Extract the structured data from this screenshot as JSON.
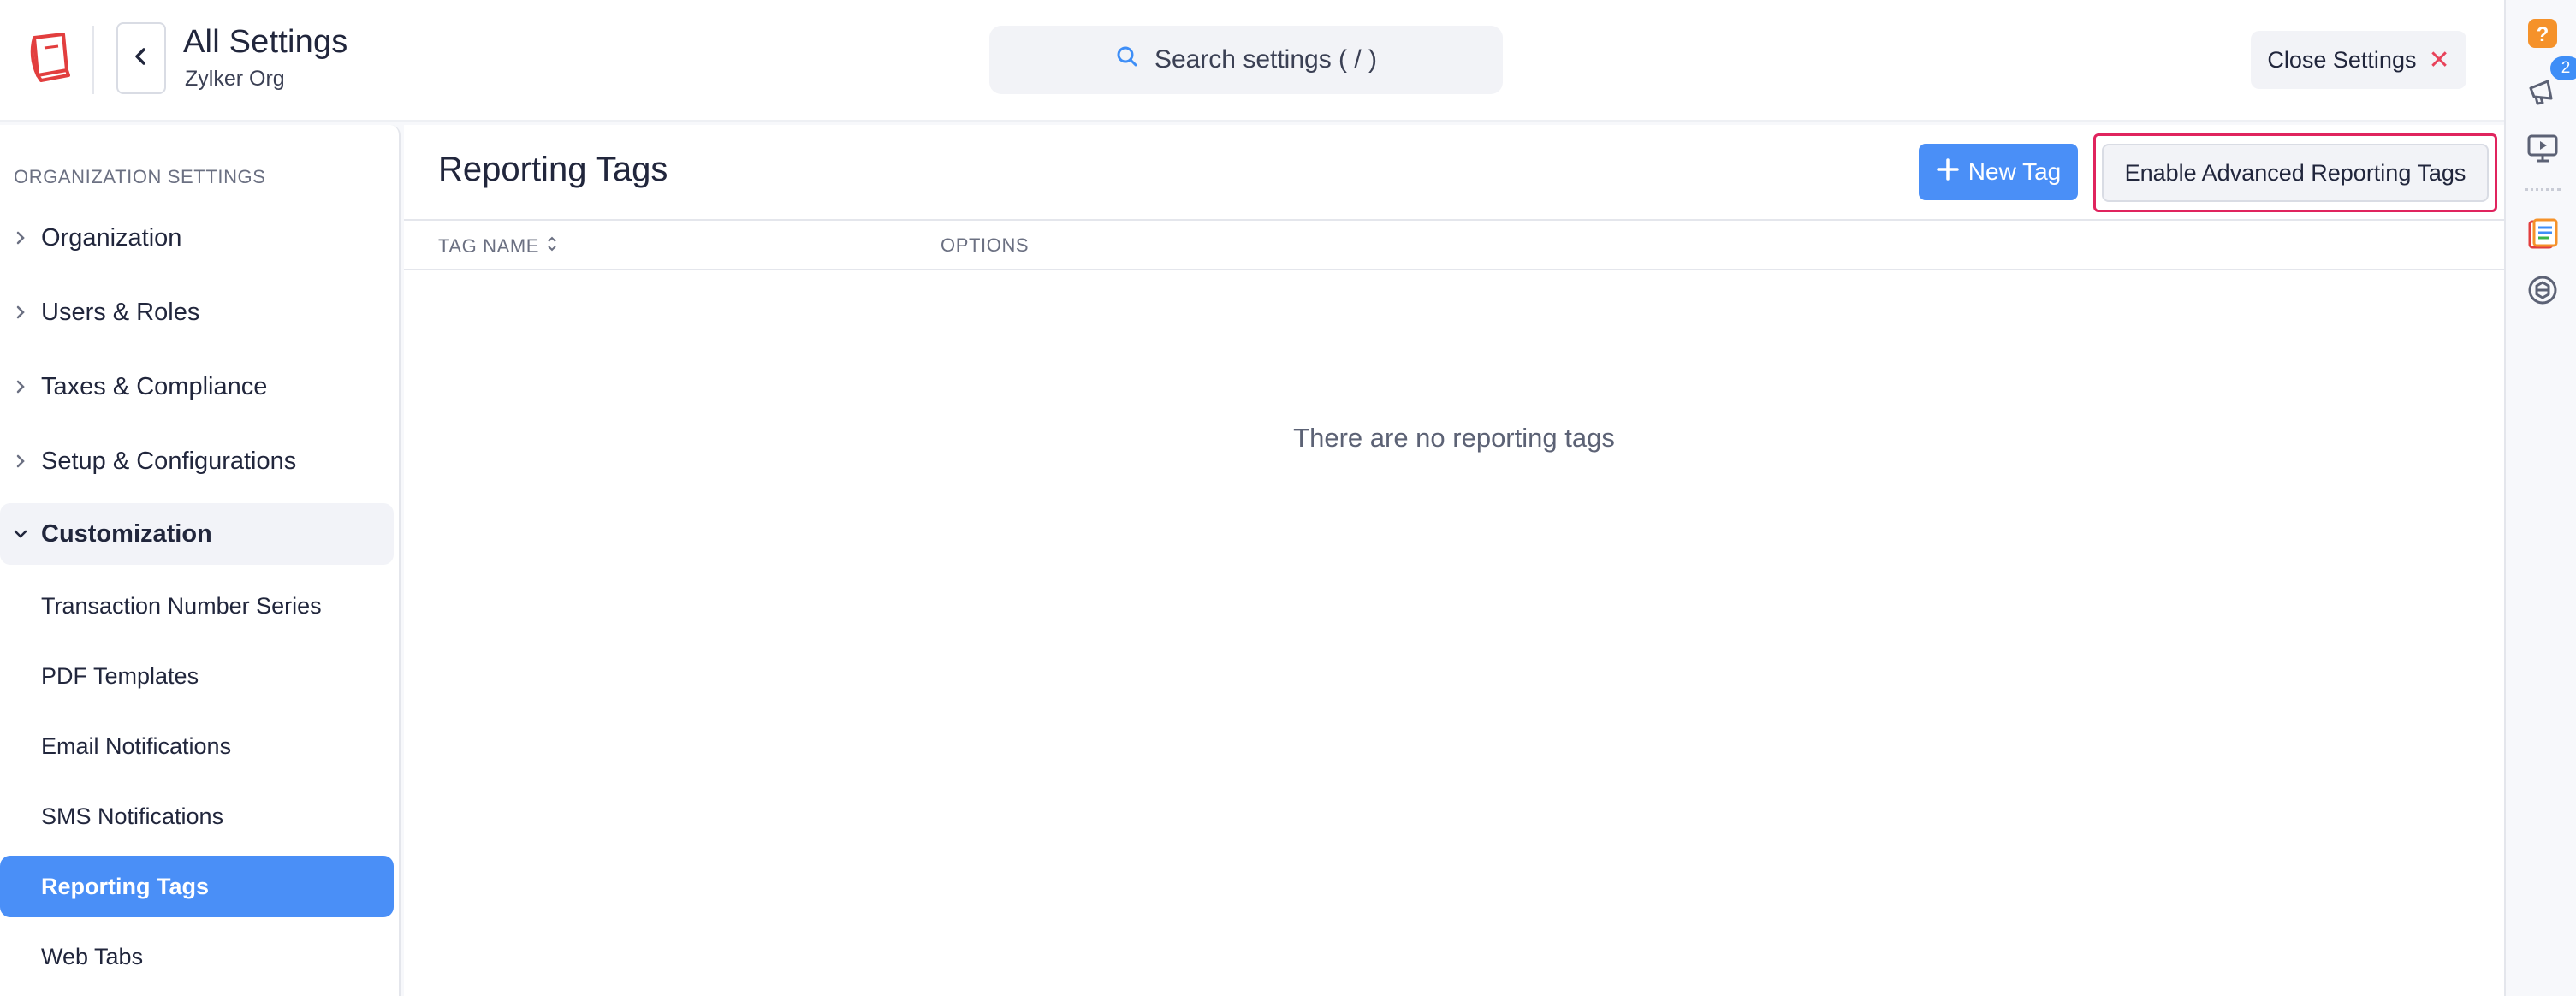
{
  "header": {
    "title": "All Settings",
    "org": "Zylker Org",
    "search_placeholder": "Search settings ( / )",
    "close_label": "Close Settings",
    "close_symbol": "✕"
  },
  "sidebar": {
    "section_label": "ORGANIZATION SETTINGS",
    "groups": [
      {
        "label": "Organization",
        "expanded": false
      },
      {
        "label": "Users & Roles",
        "expanded": false
      },
      {
        "label": "Taxes & Compliance",
        "expanded": false
      },
      {
        "label": "Setup & Configurations",
        "expanded": false
      },
      {
        "label": "Customization",
        "expanded": true
      }
    ],
    "sub_items": [
      {
        "label": "Transaction Number Series",
        "active": false
      },
      {
        "label": "PDF Templates",
        "active": false
      },
      {
        "label": "Email Notifications",
        "active": false
      },
      {
        "label": "SMS Notifications",
        "active": false
      },
      {
        "label": "Reporting Tags",
        "active": true
      },
      {
        "label": "Web Tabs",
        "active": false
      }
    ]
  },
  "main": {
    "title": "Reporting Tags",
    "new_tag_label": "New Tag",
    "advanced_label": "Enable Advanced Reporting Tags",
    "columns": [
      "TAG NAME",
      "OPTIONS"
    ],
    "empty_message": "There are no reporting tags"
  },
  "rail": {
    "notification_count": "2"
  },
  "colors": {
    "accent": "#4a8ff7",
    "highlight_border": "#e0245e",
    "close_red": "#e8425a",
    "help_orange": "#f5922a"
  }
}
